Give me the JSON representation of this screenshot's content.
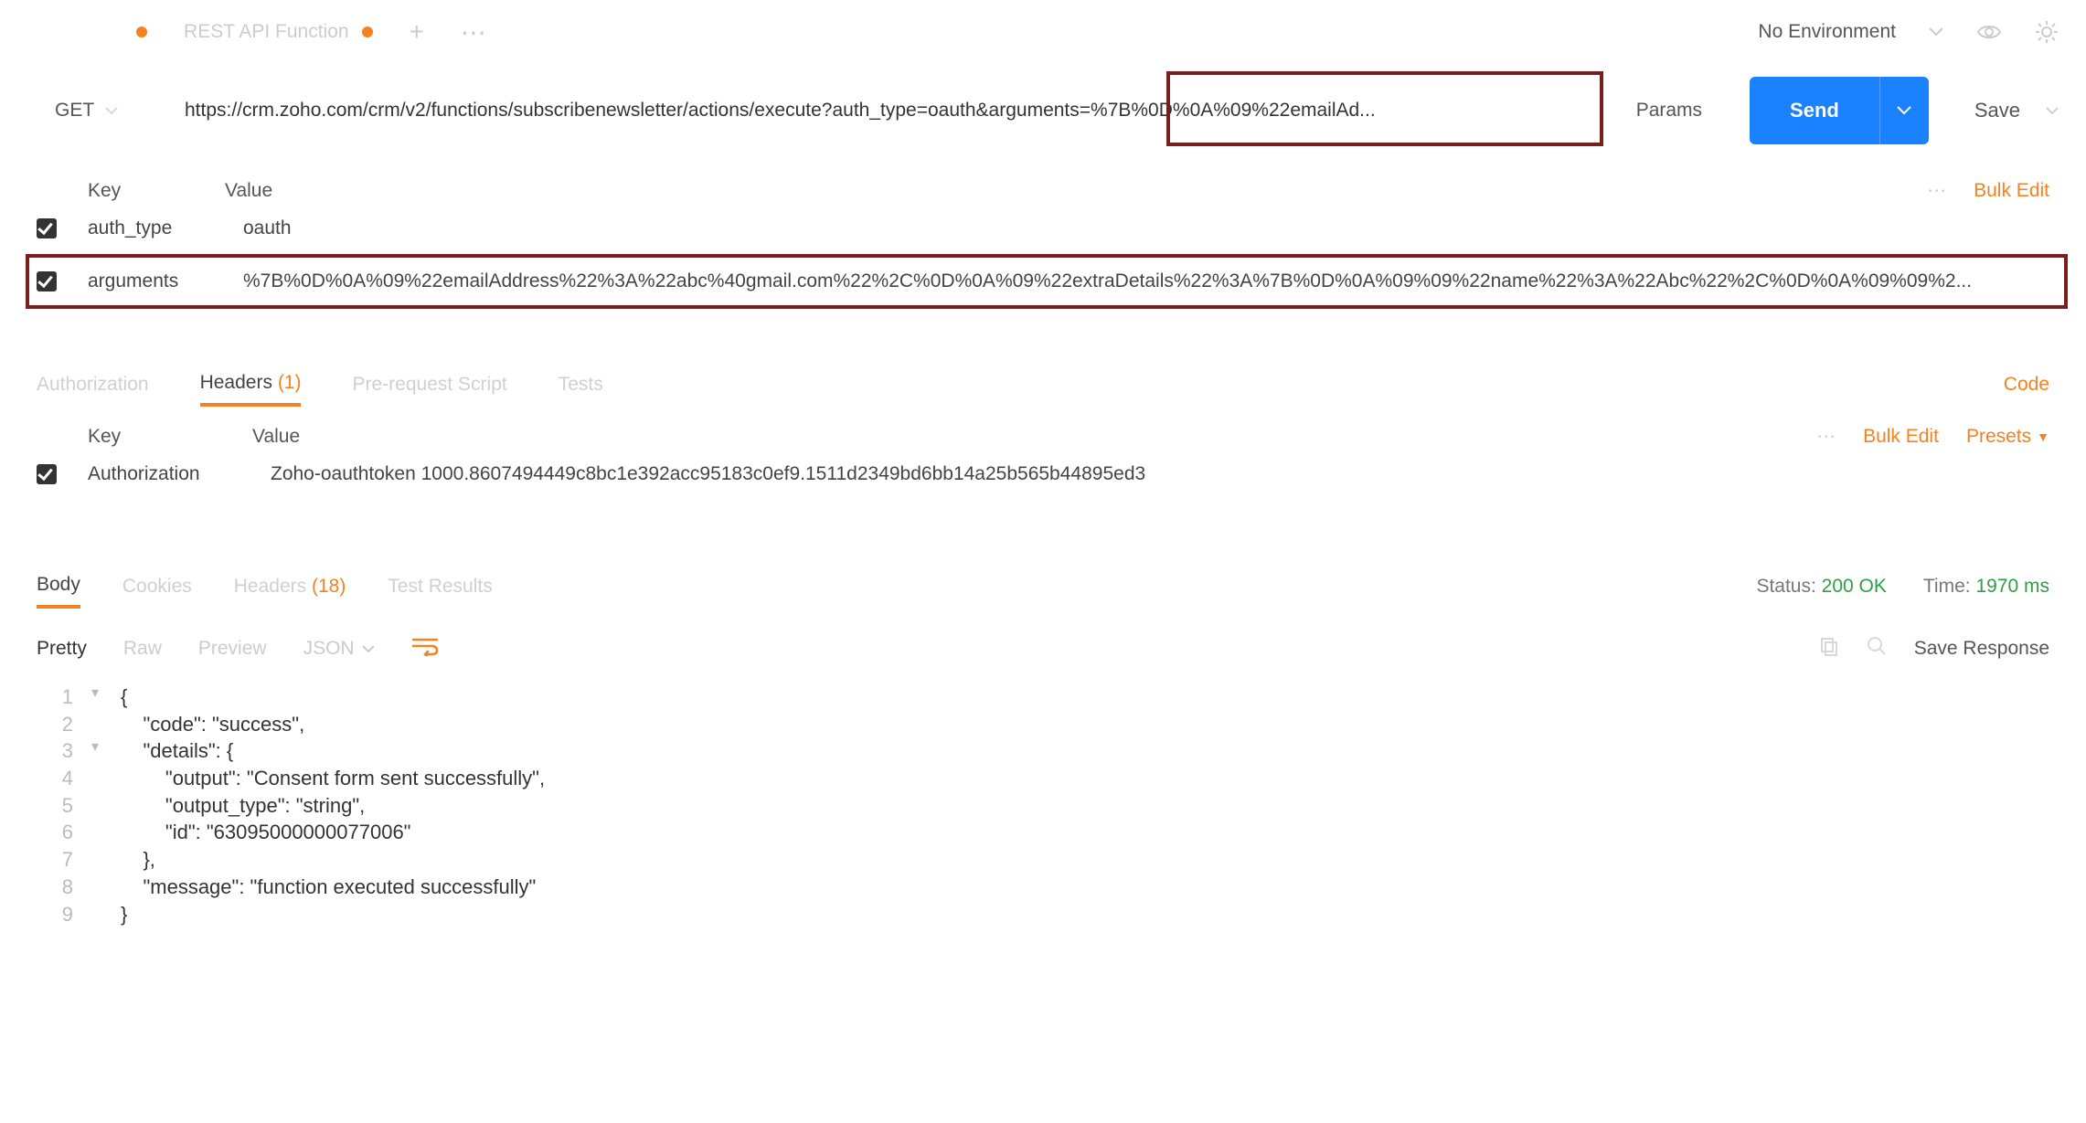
{
  "topbar": {
    "tabs": [
      {
        "label": ""
      },
      {
        "label": "REST API Function"
      }
    ],
    "environment": "No Environment"
  },
  "request": {
    "method": "GET",
    "url": "https://crm.zoho.com/crm/v2/functions/subscribenewsletter/actions/execute?auth_type=oauth&arguments=%7B%0D%0A%09%22emailAd...",
    "params_label": "Params",
    "send_label": "Send",
    "save_label": "Save"
  },
  "params": {
    "key_label": "Key",
    "value_label": "Value",
    "bulk_edit": "Bulk Edit",
    "rows": [
      {
        "key": "auth_type",
        "value": "oauth"
      },
      {
        "key": "arguments",
        "value": "%7B%0D%0A%09%22emailAddress%22%3A%22abc%40gmail.com%22%2C%0D%0A%09%22extraDetails%22%3A%7B%0D%0A%09%09%22name%22%3A%22Abc%22%2C%0D%0A%09%09%2..."
      }
    ]
  },
  "req_tabs": {
    "auth": "Authorization",
    "headers": "Headers",
    "headers_count": "(1)",
    "pre": "Pre-request Script",
    "tests": "Tests",
    "code": "Code"
  },
  "headers": {
    "key_label": "Key",
    "value_label": "Value",
    "bulk_edit": "Bulk Edit",
    "presets": "Presets",
    "rows": [
      {
        "key": "Authorization",
        "value": "Zoho-oauthtoken 1000.8607494449c8bc1e392acc95183c0ef9.1511d2349bd6bb14a25b565b44895ed3"
      }
    ]
  },
  "resp_tabs": {
    "body": "Body",
    "cookies": "Cookies",
    "headers": "Headers",
    "headers_count": "(18)",
    "tests": "Test Results",
    "status_label": "Status:",
    "status_value": "200 OK",
    "time_label": "Time:",
    "time_value": "1970 ms"
  },
  "body_controls": {
    "pretty": "Pretty",
    "raw": "Raw",
    "preview": "Preview",
    "format": "JSON",
    "save_response": "Save Response"
  },
  "response_json_lines": [
    "{",
    "    \"code\": \"success\",",
    "    \"details\": {",
    "        \"output\": \"Consent form sent successfully\",",
    "        \"output_type\": \"string\",",
    "        \"id\": \"63095000000077006\"",
    "    },",
    "    \"message\": \"function executed successfully\"",
    "}"
  ]
}
